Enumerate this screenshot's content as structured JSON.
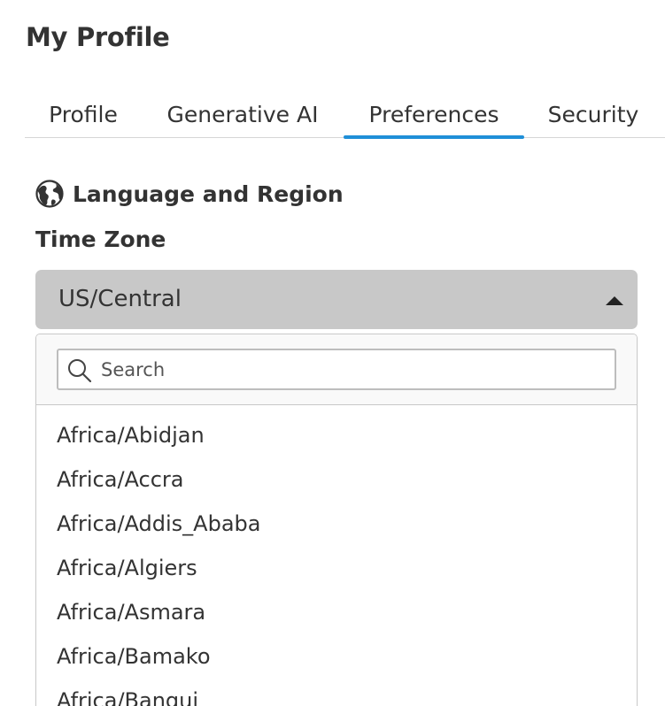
{
  "page": {
    "title": "My Profile"
  },
  "tabs": [
    {
      "label": "Profile",
      "active": false
    },
    {
      "label": "Generative AI",
      "active": false
    },
    {
      "label": "Preferences",
      "active": true
    },
    {
      "label": "Security",
      "active": false
    }
  ],
  "section": {
    "icon": "globe-icon",
    "title": "Language and Region"
  },
  "time_zone": {
    "label": "Time Zone",
    "selected": "US/Central",
    "expanded": true,
    "search_placeholder": "Search",
    "search_value": "",
    "options": [
      "Africa/Abidjan",
      "Africa/Accra",
      "Africa/Addis_Ababa",
      "Africa/Algiers",
      "Africa/Asmara",
      "Africa/Bamako",
      "Africa/Bangui"
    ]
  },
  "colors": {
    "accent": "#1f8fd8",
    "select_bg": "#c8c8c8",
    "text": "#333333"
  }
}
